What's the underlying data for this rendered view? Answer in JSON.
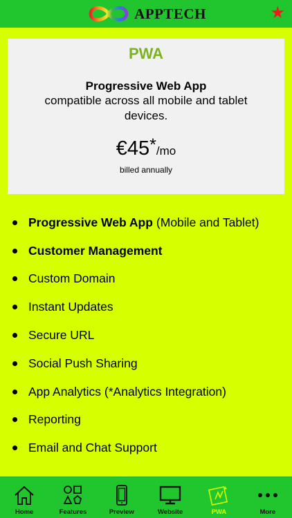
{
  "header": {
    "app_name": "APPTECH",
    "logo_icon": "infinity-logo-icon",
    "favorite_icon": "star-icon",
    "favorite_glyph": "★",
    "favorite_color": "#ee1b1b"
  },
  "plan": {
    "name": "PWA",
    "title": "Progressive Web App",
    "description": "compatible across all mobile and tablet devices.",
    "price": "€45",
    "price_asterisk": "*",
    "period": "/mo",
    "billing": "billed annually"
  },
  "features": [
    {
      "bold": "Progressive Web App",
      "text": "(Mobile and Tablet)"
    },
    {
      "bold": "Customer Management",
      "text": ""
    },
    {
      "bold": "",
      "text": "Custom Domain"
    },
    {
      "bold": "",
      "text": "Instant Updates"
    },
    {
      "bold": "",
      "text": "Secure URL"
    },
    {
      "bold": "",
      "text": "Social Push Sharing"
    },
    {
      "bold": "",
      "text": "App Analytics (*Analytics Integration)"
    },
    {
      "bold": "",
      "text": "Reporting"
    },
    {
      "bold": "",
      "text": "Email and Chat Support"
    }
  ],
  "tabbar": {
    "tabs": [
      {
        "label": "Home",
        "icon": "home-icon"
      },
      {
        "label": "Features",
        "icon": "shapes-icon"
      },
      {
        "label": "Preview",
        "icon": "phone-icon"
      },
      {
        "label": "Website",
        "icon": "monitor-icon"
      },
      {
        "label": "PWA",
        "icon": "pwa-icon"
      },
      {
        "label": "More",
        "icon": "more-dots-icon"
      }
    ],
    "active_tab": "PWA"
  },
  "colors": {
    "background": "#d6ff00",
    "bar": "#21c62f",
    "card": "#f1f1f1",
    "plan_name": "#7ab31f"
  }
}
